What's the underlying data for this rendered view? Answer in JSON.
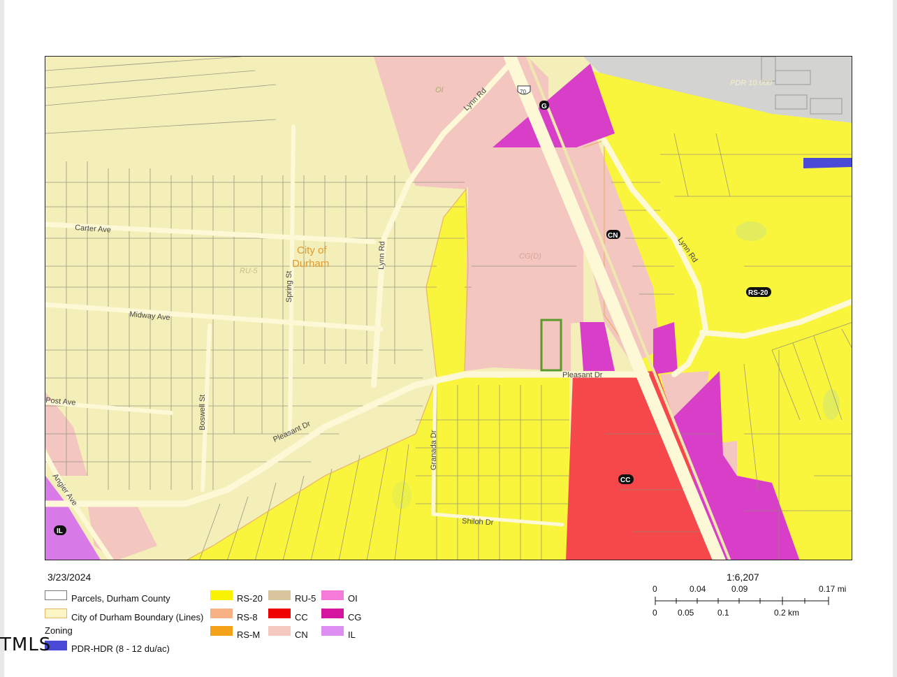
{
  "map": {
    "roads": {
      "carter_ave": "Carter Ave",
      "midway_ave": "Midway Ave",
      "post_ave": "Post Ave",
      "boswell_st": "Boswell St",
      "spring_st": "Spring St",
      "lynn_rd_north": "Lynn Rd",
      "lynn_rd_mid": "Lynn Rd",
      "lynn_rd_east": "Lynn Rd",
      "pleasant_dr_west": "Pleasant Dr",
      "pleasant_dr_east": "Pleasant Dr",
      "granada_dr": "Granada Dr",
      "shiloh_dr": "Shiloh Dr",
      "angier_ave": "Angier Ave",
      "us70_shield": "70"
    },
    "city_label_line1": "City of",
    "city_label_line2": "Durham",
    "zone_labels": {
      "oi": "OI",
      "pdr": "PDR 10.000",
      "cg_small": "G",
      "cn": "CN",
      "cgd": "CG(D)",
      "ru5": "RU-5",
      "rs20": "RS-20",
      "cc": "CC",
      "il": "IL"
    },
    "colors": {
      "rs20": "#f9f53d",
      "ru5_city": "#f4efb8",
      "cn": "#f3c6c0",
      "cc": "#f6474a",
      "cg": "#d93ec9",
      "pdr": "#d3d3d1",
      "il": "#d87ae8",
      "subject_parcel_outline": "#5a9a2a",
      "road": "#fdf8d6"
    }
  },
  "footer": {
    "date": "3/23/2024",
    "scale_ratio": "1:6,207",
    "scale_top_ticks": [
      "0",
      "0.04",
      "0.09",
      "0.17 mi"
    ],
    "scale_bottom_ticks": [
      "0",
      "0.05",
      "0.1",
      "0.2 km"
    ]
  },
  "legend": {
    "parcels": "Parcels, Durham County",
    "city_boundary": "City of Durham Boundary (Lines)",
    "zoning_heading": "Zoning",
    "items": [
      {
        "label": "PDR-HDR (8 - 12 du/ac)",
        "color": "#4a4ad6"
      },
      {
        "label": "RS-20",
        "color": "#f9f200"
      },
      {
        "label": "RS-8",
        "color": "#f8b184"
      },
      {
        "label": "RS-M",
        "color": "#f3a21a"
      },
      {
        "label": "RU-5",
        "color": "#d8c49e"
      },
      {
        "label": "CC",
        "color": "#ee0000"
      },
      {
        "label": "CN",
        "color": "#f5c9bf"
      },
      {
        "label": "OI",
        "color": "#f67ad8"
      },
      {
        "label": "CG",
        "color": "#d4149e"
      },
      {
        "label": "IL",
        "color": "#dd8ef2"
      }
    ]
  },
  "watermark": "TMLS"
}
